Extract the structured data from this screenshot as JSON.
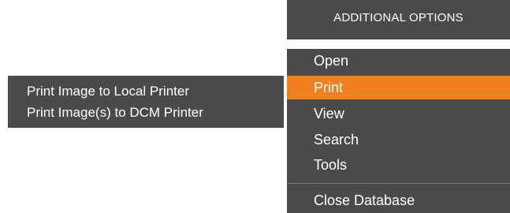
{
  "header": {
    "title": "ADDITIONAL OPTIONS"
  },
  "menu": {
    "items": [
      {
        "label": "Open",
        "active": false
      },
      {
        "label": "Print",
        "active": true
      },
      {
        "label": "View",
        "active": false
      },
      {
        "label": "Search",
        "active": false
      },
      {
        "label": "Tools",
        "active": false
      },
      {
        "label": "Close Database",
        "active": false
      }
    ]
  },
  "submenu": {
    "items": [
      {
        "label": "Print Image to Local Printer"
      },
      {
        "label": "Print Image(s) to DCM Printer"
      }
    ]
  },
  "colors": {
    "panel_bg": "#4a4a4a",
    "accent": "#f07f1f",
    "text": "#ffffff"
  }
}
